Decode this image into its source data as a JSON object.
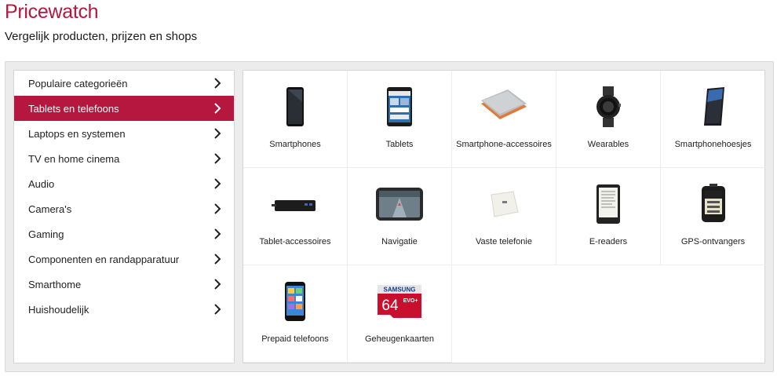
{
  "header": {
    "title": "Pricewatch",
    "subtitle": "Vergelijk producten, prijzen en shops"
  },
  "sidebar": {
    "items": [
      {
        "label": "Populaire categorieën",
        "active": false
      },
      {
        "label": "Tablets en telefoons",
        "active": true
      },
      {
        "label": "Laptops en systemen",
        "active": false
      },
      {
        "label": "TV en home cinema",
        "active": false
      },
      {
        "label": "Audio",
        "active": false
      },
      {
        "label": "Camera's",
        "active": false
      },
      {
        "label": "Gaming",
        "active": false
      },
      {
        "label": "Componenten en randapparatuur",
        "active": false
      },
      {
        "label": "Smarthome",
        "active": false
      },
      {
        "label": "Huishoudelijk",
        "active": false
      }
    ]
  },
  "categories": [
    {
      "label": "Smartphones",
      "icon": "smartphone-icon"
    },
    {
      "label": "Tablets",
      "icon": "tablet-icon"
    },
    {
      "label": "Smartphone-accessoires",
      "icon": "powerbank-icon"
    },
    {
      "label": "Wearables",
      "icon": "smartwatch-icon"
    },
    {
      "label": "Smartphonehoesjes",
      "icon": "phone-case-icon"
    },
    {
      "label": "Tablet-accessoires",
      "icon": "dock-icon"
    },
    {
      "label": "Navigatie",
      "icon": "gps-navigator-icon"
    },
    {
      "label": "Vaste telefonie",
      "icon": "landline-base-icon"
    },
    {
      "label": "E-readers",
      "icon": "ereader-icon"
    },
    {
      "label": "GPS-ontvangers",
      "icon": "bike-computer-icon"
    },
    {
      "label": "Prepaid telefoons",
      "icon": "prepaid-phone-icon"
    },
    {
      "label": "Geheugenkaarten",
      "icon": "memory-card-icon"
    }
  ],
  "memory_card": {
    "brand": "SAMSUNG",
    "capacity": "64",
    "series": "EVO+"
  },
  "colors": {
    "accent": "#b5173f",
    "frame": "#ececec"
  }
}
